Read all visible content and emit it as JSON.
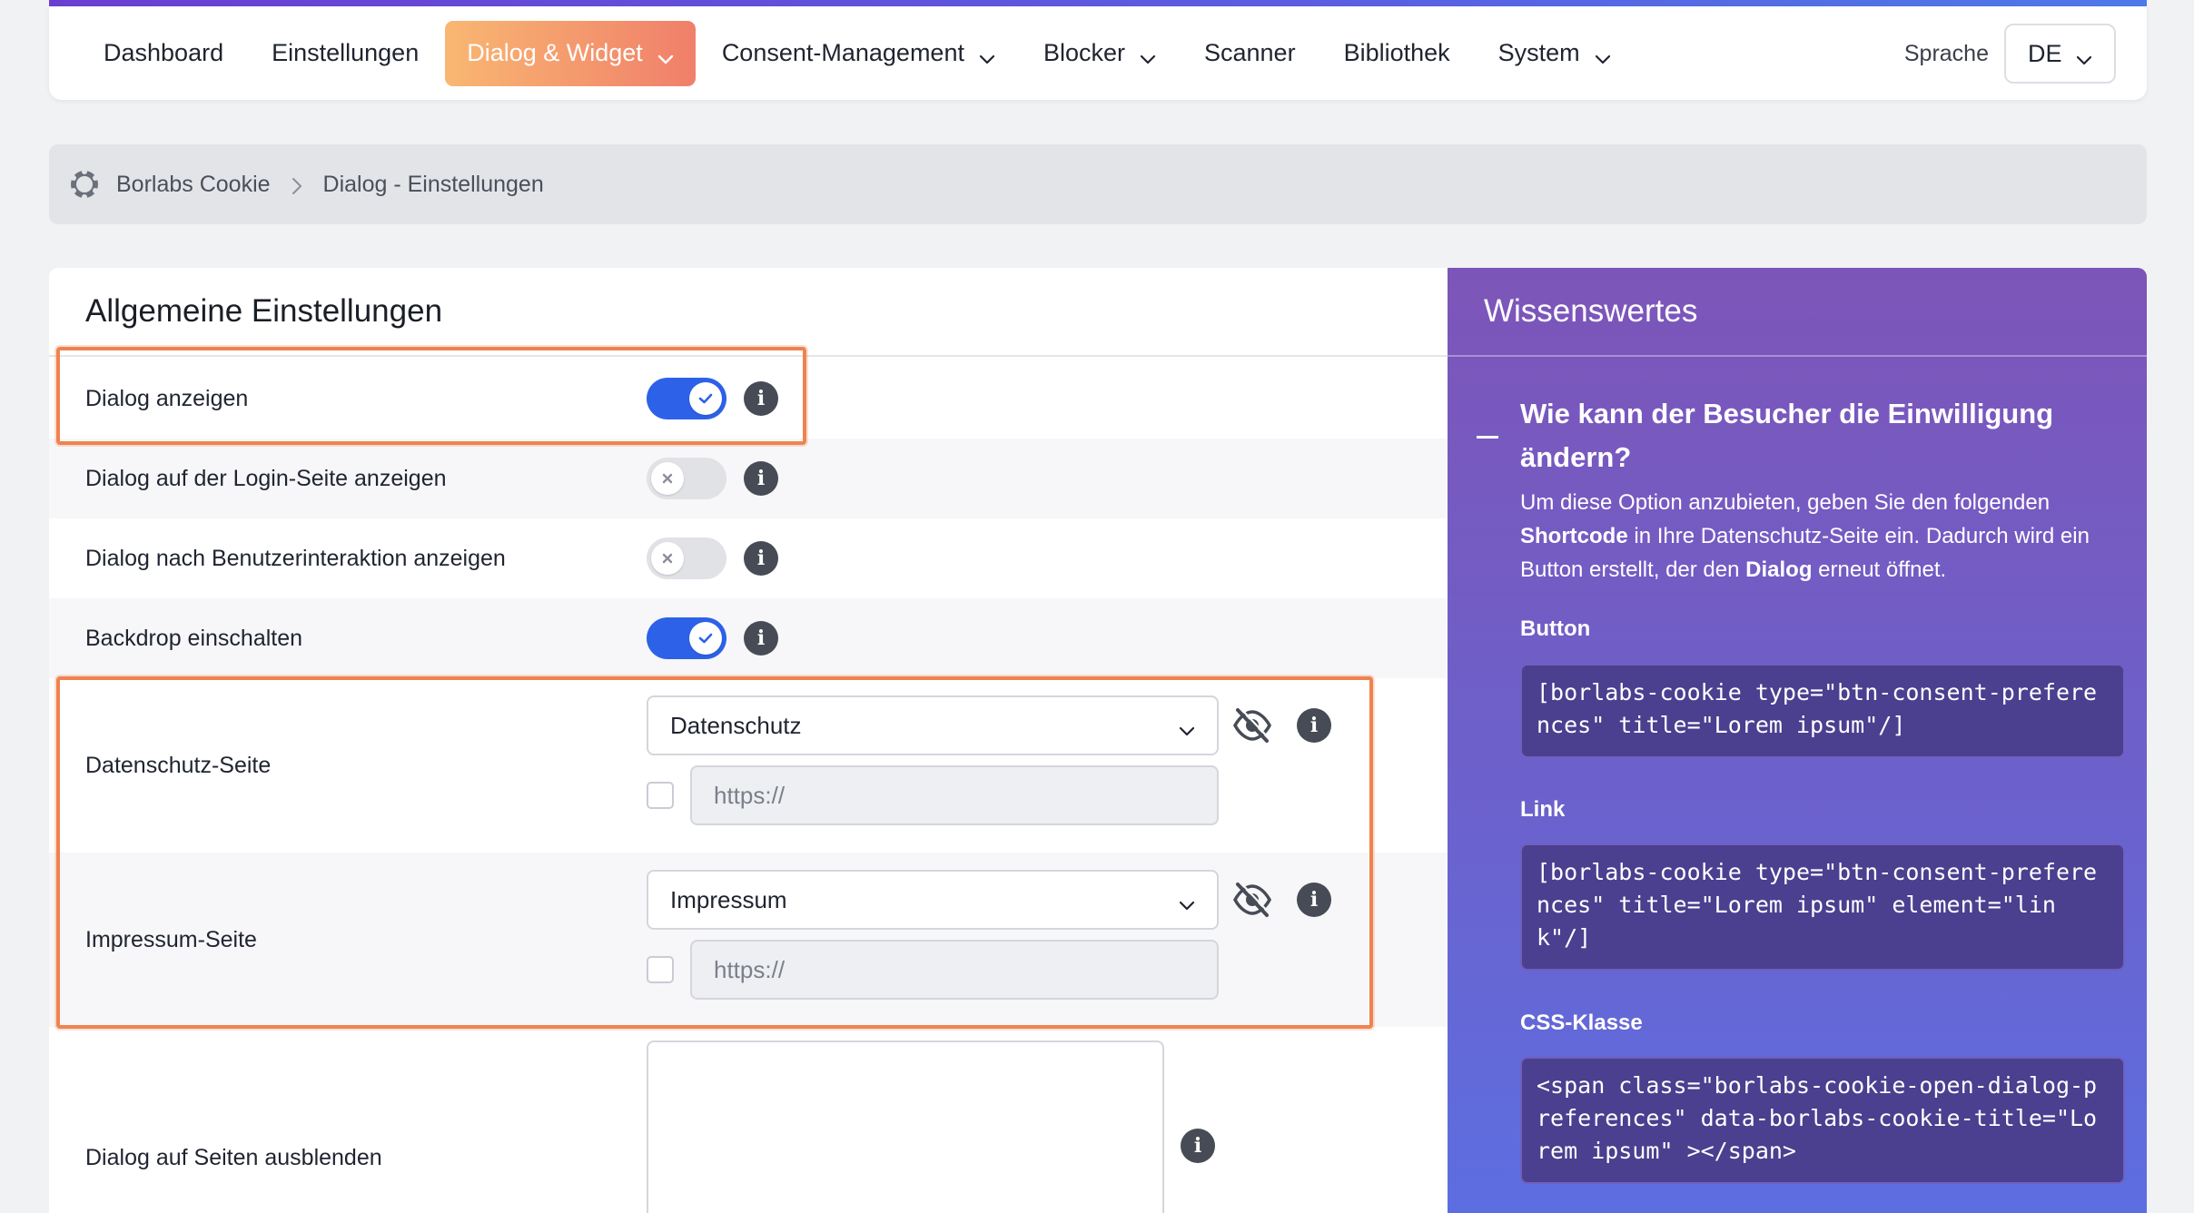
{
  "nav": {
    "items": [
      {
        "label": "Dashboard",
        "dropdown": false,
        "active": false
      },
      {
        "label": "Einstellungen",
        "dropdown": false,
        "active": false
      },
      {
        "label": "Dialog & Widget",
        "dropdown": true,
        "active": true
      },
      {
        "label": "Consent-Management",
        "dropdown": true,
        "active": false
      },
      {
        "label": "Blocker",
        "dropdown": true,
        "active": false
      },
      {
        "label": "Scanner",
        "dropdown": false,
        "active": false
      },
      {
        "label": "Bibliothek",
        "dropdown": false,
        "active": false
      },
      {
        "label": "System",
        "dropdown": true,
        "active": false
      }
    ],
    "language_label": "Sprache",
    "language_value": "DE"
  },
  "breadcrumb": {
    "root": "Borlabs Cookie",
    "current": "Dialog - Einstellungen"
  },
  "general": {
    "title": "Allgemeine Einstellungen",
    "rows": [
      {
        "label": "Dialog anzeigen",
        "enabled": true
      },
      {
        "label": "Dialog auf der Login-Seite anzeigen",
        "enabled": false
      },
      {
        "label": "Dialog nach Benutzerinteraktion anzeigen",
        "enabled": false
      },
      {
        "label": "Backdrop einschalten",
        "enabled": true
      }
    ],
    "privacy_page": {
      "label": "Datenschutz-Seite",
      "selected": "Datenschutz",
      "url_placeholder": "https://",
      "custom_url_checked": false
    },
    "imprint_page": {
      "label": "Impressum-Seite",
      "selected": "Impressum",
      "url_placeholder": "https://",
      "custom_url_checked": false
    },
    "hide_on_pages": {
      "label": "Dialog auf Seiten ausblenden",
      "value": ""
    }
  },
  "side": {
    "title": "Wissenswertes",
    "question": "Wie kann der Besucher die Einwilligung ändern?",
    "answer_part1": "Um diese Option anzubieten, geben Sie den folgenden ",
    "answer_bold1": "Shortcode",
    "answer_part2": " in Ihre Datenschutz-Seite ein. Dadurch wird ein Button erstellt, der den ",
    "answer_bold2": "Dialog",
    "answer_part3": " erneut öffnet.",
    "button_label": "Button",
    "button_code": "[borlabs-cookie type=\"btn-consent-preferences\" title=\"Lorem ipsum\"/]",
    "link_label": "Link",
    "link_code": "[borlabs-cookie type=\"btn-consent-preferences\" title=\"Lorem ipsum\" element=\"link\"/]",
    "css_label": "CSS-Klasse",
    "css_code": "<span class=\"borlabs-cookie-open-dialog-preferences\" data-borlabs-cookie-title=\"Lorem ipsum\" ></span>"
  },
  "colors": {
    "accent": "#2d62e8",
    "nav_active_start": "#f9b772",
    "nav_active_end": "#f07f6a",
    "highlight": "#ef8350",
    "side_panel": "#6c61cc"
  }
}
